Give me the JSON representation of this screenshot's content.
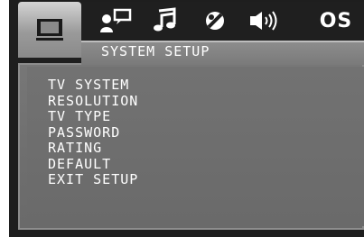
{
  "header": {
    "title": "SYSTEM SETUP",
    "tabs": [
      {
        "icon": "tv-icon",
        "active": true
      },
      {
        "icon": "language-icon",
        "active": false
      },
      {
        "icon": "audio-icon",
        "active": false
      },
      {
        "icon": "video-icon",
        "active": false
      },
      {
        "icon": "speaker-icon",
        "active": false
      },
      {
        "icon": "os-icon",
        "label": "OS",
        "active": false
      }
    ]
  },
  "menu": {
    "items": [
      {
        "label": "TV SYSTEM"
      },
      {
        "label": "RESOLUTION"
      },
      {
        "label": "TV TYPE"
      },
      {
        "label": "PASSWORD"
      },
      {
        "label": "RATING"
      },
      {
        "label": "DEFAULT"
      },
      {
        "label": "EXIT SETUP"
      }
    ]
  },
  "colors": {
    "background": "#1e1e1e",
    "panel": "#727272",
    "active_tab": "#c8c8c8",
    "text": "#ffffff"
  }
}
